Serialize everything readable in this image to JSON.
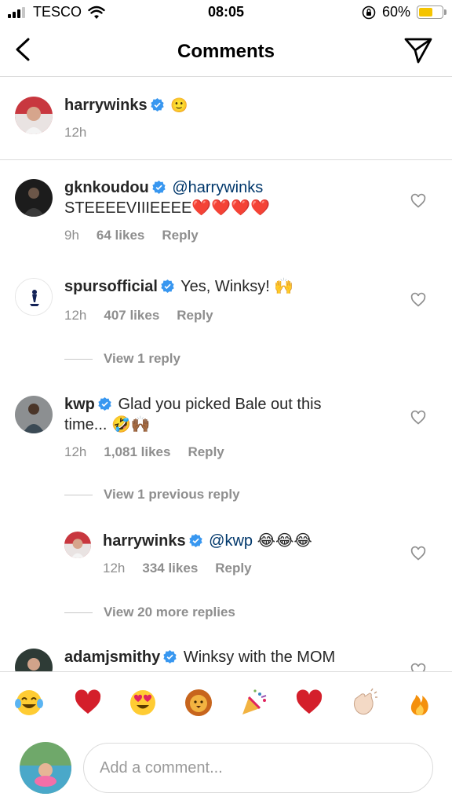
{
  "status_bar": {
    "carrier": "TESCO",
    "time": "08:05",
    "battery_percent": "60%",
    "battery_level": 0.6
  },
  "nav": {
    "title": "Comments"
  },
  "caption": {
    "username": "harrywinks",
    "text": "🙂",
    "time": "12h"
  },
  "comments": [
    {
      "username": "gknkoudou",
      "mention": "@harrywinks",
      "text": "STEEEEVIIIEEEE❤️❤️❤️❤️",
      "time": "9h",
      "likes": "64 likes",
      "reply": "Reply"
    },
    {
      "username": "spursofficial",
      "text": "Yes, Winksy! 🙌",
      "time": "12h",
      "likes": "407 likes",
      "reply": "Reply",
      "view_replies": "View 1 reply"
    },
    {
      "username": "kwp",
      "text": "Glad you picked Bale out this time... 🤣🙌🏾",
      "time": "12h",
      "likes": "1,081 likes",
      "reply": "Reply",
      "view_previous": "View 1 previous reply"
    },
    {
      "username": "harrywinks",
      "mention": "@kwp",
      "text": "😂😂😂",
      "time": "12h",
      "likes": "334 likes",
      "reply": "Reply",
      "view_more": "View 20 more replies"
    },
    {
      "username": "adamjsmithy",
      "text": "Winksy with the MOM"
    }
  ],
  "emoji_bar": [
    "😂",
    "❤️",
    "😍",
    "🦁",
    "🎉",
    "❤️",
    "👏🏻",
    "🔥"
  ],
  "composer": {
    "placeholder": "Add a comment..."
  },
  "colors": {
    "verified": "#3897f0",
    "mention": "#00376b",
    "meta": "#8e8e8e",
    "divider": "#dbdbdb"
  }
}
